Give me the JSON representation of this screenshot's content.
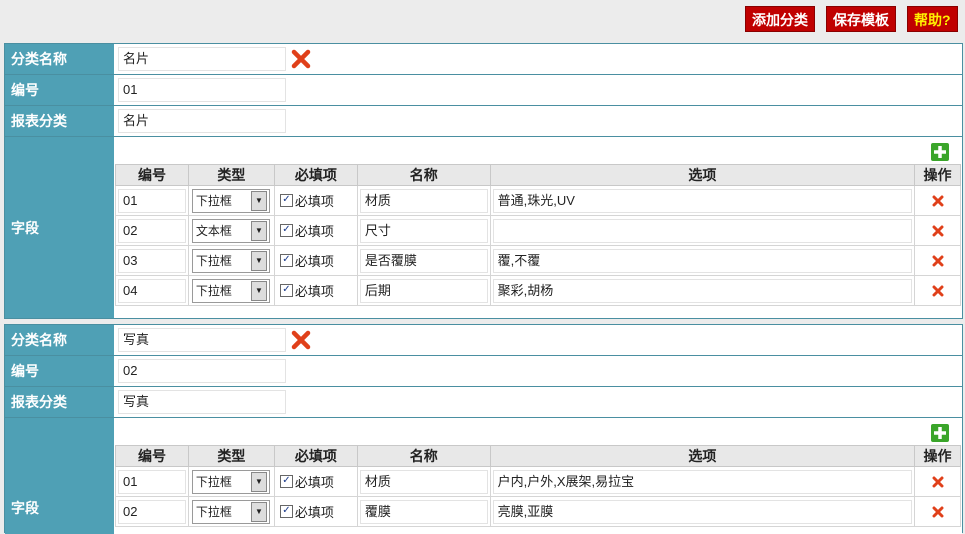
{
  "toolbar": {
    "add_category": "添加分类",
    "save_template": "保存模板",
    "help": "帮助?"
  },
  "labels": {
    "category_name": "分类名称",
    "number": "编号",
    "report_category": "报表分类",
    "fields": "字段"
  },
  "columns": [
    "编号",
    "类型",
    "必填项",
    "名称",
    "选项",
    "操作"
  ],
  "categories": [
    {
      "name": "名片",
      "number": "01",
      "report": "名片",
      "fields": [
        {
          "no": "01",
          "type": "下拉框",
          "required": "必填项",
          "name": "材质",
          "options": "普通,珠光,UV"
        },
        {
          "no": "02",
          "type": "文本框",
          "required": "必填项",
          "name": "尺寸",
          "options": ""
        },
        {
          "no": "03",
          "type": "下拉框",
          "required": "必填项",
          "name": "是否覆膜",
          "options": "覆,不覆"
        },
        {
          "no": "04",
          "type": "下拉框",
          "required": "必填项",
          "name": "后期",
          "options": "聚彩,胡杨"
        }
      ]
    },
    {
      "name": "写真",
      "number": "02",
      "report": "写真",
      "fields": [
        {
          "no": "01",
          "type": "下拉框",
          "required": "必填项",
          "name": "材质",
          "options": "户内,户外,X展架,易拉宝"
        },
        {
          "no": "02",
          "type": "下拉框",
          "required": "必填项",
          "name": "覆膜",
          "options": "亮膜,亚膜"
        }
      ]
    }
  ],
  "colors": {
    "label_bg": "#4fa0b5",
    "border": "#4a8fa1",
    "button_bg": "#c00000",
    "help_text": "#ffef00",
    "delete_icon": "#e0401a",
    "add_icon": "#3aa52a"
  }
}
